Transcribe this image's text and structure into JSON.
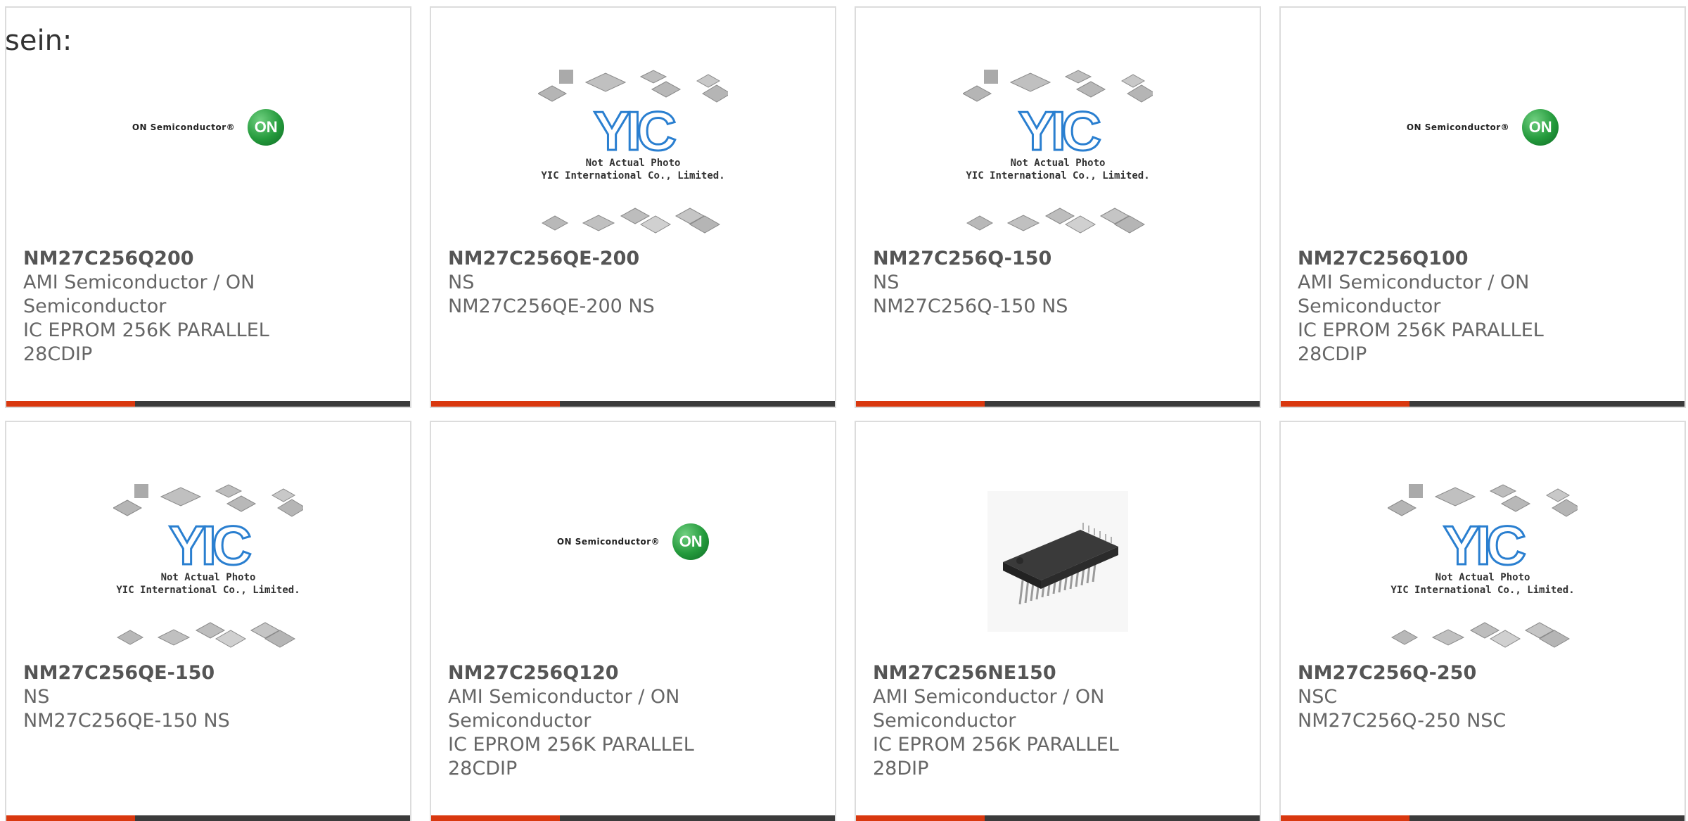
{
  "intro_text": "sein:",
  "placeholder_caption_line1": "Not Actual Photo",
  "placeholder_caption_line2": "YIC International Co., Limited.",
  "placeholder_logo_text": "YIC",
  "on_logo_text": "ON Semiconductor®",
  "on_logo_badge": "ON",
  "colors": {
    "accent": "#d9380f",
    "bar": "#3b3b3b",
    "border": "#dcdcdc"
  },
  "products": [
    {
      "part": "NM27C256Q200",
      "manufacturer": "AMI Semiconductor / ON Semiconductor",
      "description": "IC EPROM 256K PARALLEL 28CDIP",
      "image": "on-semiconductor-logo"
    },
    {
      "part": "NM27C256QE-200",
      "manufacturer": "NS",
      "description": "NM27C256QE-200 NS",
      "image": "yic-placeholder"
    },
    {
      "part": "NM27C256Q-150",
      "manufacturer": "NS",
      "description": "NM27C256Q-150 NS",
      "image": "yic-placeholder"
    },
    {
      "part": "NM27C256Q100",
      "manufacturer": "AMI Semiconductor / ON Semiconductor",
      "description": "IC EPROM 256K PARALLEL 28CDIP",
      "image": "on-semiconductor-logo"
    },
    {
      "part": "NM27C256QE-150",
      "manufacturer": "NS",
      "description": "NM27C256QE-150 NS",
      "image": "yic-placeholder"
    },
    {
      "part": "NM27C256Q120",
      "manufacturer": "AMI Semiconductor / ON Semiconductor",
      "description": "IC EPROM 256K PARALLEL 28CDIP",
      "image": "on-semiconductor-logo"
    },
    {
      "part": "NM27C256NE150",
      "manufacturer": "AMI Semiconductor / ON Semiconductor",
      "description": "IC EPROM 256K PARALLEL 28DIP",
      "image": "dip-chip-photo"
    },
    {
      "part": "NM27C256Q-250",
      "manufacturer": "NSC",
      "description": "NM27C256Q-250 NSC",
      "image": "yic-placeholder"
    }
  ]
}
